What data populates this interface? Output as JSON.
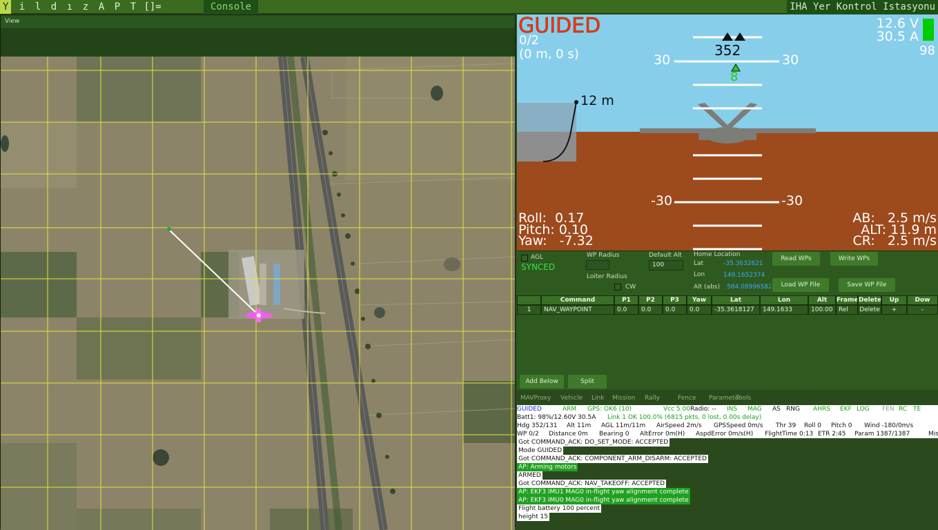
{
  "topbar": {
    "menu_icon": "Y",
    "menu_letters": [
      "i",
      "l",
      "d",
      "ı",
      "z",
      "A",
      "P",
      "T"
    ],
    "menu_icon2": "[]=",
    "console_tab": "Console",
    "window_title": "IHA Yer Kontrol Istasyonu"
  },
  "map": {
    "menu_view": "View",
    "icons": [
      "aircraft-icon",
      "waypoint-marker-icon"
    ]
  },
  "hud": {
    "mode": "GUIDED",
    "wp_progress": "0/2",
    "wp_distance": "(0 m, 0 s)",
    "battery_voltage": "12.6 V",
    "battery_current": "30.5 A",
    "battery_percent": "98",
    "heading": "352",
    "ladder_upper_left": "30",
    "ladder_upper_right": "30",
    "ladder_lower_left": "-30",
    "ladder_lower_right": "-30",
    "target_alt_marker": "8",
    "altitude_bar_label": "12 m",
    "roll": "Roll:  0.17",
    "pitch": "Pitch: 0.10",
    "yaw": "Yaw:   -7.32",
    "airspeed": "AB:   2.5 m/s",
    "alt": "ALT: 11.9 m",
    "climb_rate": "CR:   2.5 m/s",
    "colors": {
      "sky": "#87ceeb",
      "ground": "#a0522d",
      "mode_text": "#ff3300",
      "battery_bar": "#00cc00"
    }
  },
  "mission": {
    "agl_label": "AGL",
    "synced_label": "SYNCED",
    "wp_radius_label": "WP Radius",
    "loiter_radius_label": "Loiter Radius",
    "cw_label": "CW",
    "default_alt_label": "Default Alt",
    "default_alt_value": "100",
    "home_location_label": "Home Location",
    "lat_label": "Lat",
    "lat_value": "-35.3632621",
    "lon_label": "Lon",
    "lon_value": "149.1652374",
    "alt_abs_label": "Alt (abs)",
    "alt_abs_value": "584.08996582",
    "read_wps": "Read WPs",
    "write_wps": "Write WPs",
    "load_wp_file": "Load WP File",
    "save_wp_file": "Save WP File",
    "add_below": "Add Below",
    "split": "Split",
    "table_headers": [
      "",
      "Command",
      "P1",
      "P2",
      "P3",
      "Yaw",
      "Lat",
      "Lon",
      "Alt",
      "Frame",
      "Delete",
      "Up",
      "Dow"
    ],
    "table_rows": [
      [
        "1",
        "NAV_WAYPOINT",
        "0.0",
        "0.0",
        "0.0",
        "0.0",
        "-35.3618127",
        "149.1633",
        "100.00",
        "Rel",
        "Delete",
        "+",
        "-"
      ]
    ]
  },
  "console": {
    "tabs": [
      "MAVProxy",
      "Vehicle",
      "Link",
      "Mission",
      "Rally",
      "Fence",
      "Parameter",
      "Tools"
    ],
    "status_row1": [
      {
        "text": "GUIDED",
        "color": "#1a35c8"
      },
      {
        "text": "ARM",
        "color": "#18a018"
      },
      {
        "text": "GPS: OK6 (10)",
        "color": "#18a018"
      },
      {
        "text": "Vcc 5.00",
        "color": "#18a018"
      },
      {
        "text": "Radio: --",
        "color": "#111111"
      },
      {
        "text": "INS",
        "color": "#18a018"
      },
      {
        "text": "MAG",
        "color": "#18a018"
      },
      {
        "text": "AS",
        "color": "#111111"
      },
      {
        "text": "RNG",
        "color": "#111111"
      },
      {
        "text": "AHRS",
        "color": "#18a018"
      },
      {
        "text": "EKF",
        "color": "#18a018"
      },
      {
        "text": "LOG",
        "color": "#18a018"
      },
      {
        "text": "FEN",
        "color": "#999999"
      },
      {
        "text": "RC",
        "color": "#18a018"
      },
      {
        "text": "TE",
        "color": "#18a018"
      }
    ],
    "status_row2": [
      {
        "text": "Batt1: 98%/12.60V 30.5A",
        "color": "#111111"
      },
      {
        "text": "Link 1 OK 100.0% (6815 pkts, 0 lost, 0.00s delay)",
        "color": "#18a018"
      }
    ],
    "status_row3": [
      "Hdg 352/131",
      "Alt 11m",
      "AGL 11m/11m",
      "AirSpeed 2m/s",
      "GPSSpeed 0m/s",
      "Thr 39",
      "Roll 0",
      "Pitch 0",
      "Wind -180/0m/s"
    ],
    "status_row4": [
      "WP 0/2",
      "Distance 0m",
      "Bearing 0",
      "AltError 0m(H)",
      "AspdError 0m/s(H)",
      "FlightTime 0:13",
      "ETR 2:45",
      "Param 1387/1387",
      "Mis"
    ],
    "log": [
      {
        "text": "Got COMMAND_ACK: DO_SET_MODE: ACCEPTED",
        "style": "w"
      },
      {
        "text": "Mode GUIDED",
        "style": "w"
      },
      {
        "text": "Got COMMAND_ACK: COMPONENT_ARM_DISARM: ACCEPTED",
        "style": "w"
      },
      {
        "text": "AP: Arming motors",
        "style": "g"
      },
      {
        "text": "ARMED",
        "style": "w"
      },
      {
        "text": "Got COMMAND_ACK: NAV_TAKEOFF: ACCEPTED",
        "style": "w"
      },
      {
        "text": "AP: EKF3 IMU1 MAG0 in-flight yaw alignment complete",
        "style": "g"
      },
      {
        "text": "AP: EKF3 IMU0 MAG0 in-flight yaw alignment complete",
        "style": "g"
      },
      {
        "text": "Flight battery 100 percent",
        "style": "w"
      },
      {
        "text": "height 15",
        "style": "w"
      }
    ]
  }
}
